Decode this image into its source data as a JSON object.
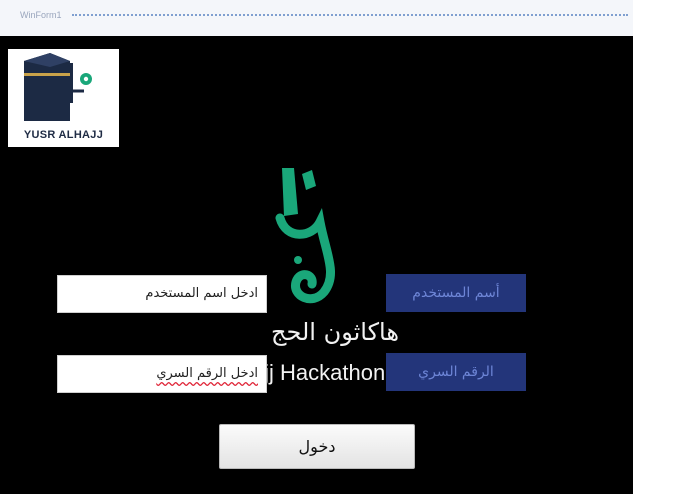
{
  "window": {
    "title": "WinForm1"
  },
  "logo": {
    "text": "YUSR ALHAJJ"
  },
  "hackathon": {
    "title_ar": "هاكاثون الحج",
    "title_en": "Hajj Hackathon"
  },
  "form": {
    "username_label": "أسم المستخدم",
    "username_value": "ادخل اسم المستخدم",
    "password_label": "الرقم السري",
    "password_value": "ادخل الرقم السري",
    "login_button": "دخول"
  },
  "colors": {
    "background": "#000000",
    "label_bg": "#23357a",
    "label_text": "#6d85d6",
    "emblem": "#1aa77a"
  },
  "icons": [
    "kaaba-logo-icon",
    "hajj-calligraphy-emblem"
  ]
}
